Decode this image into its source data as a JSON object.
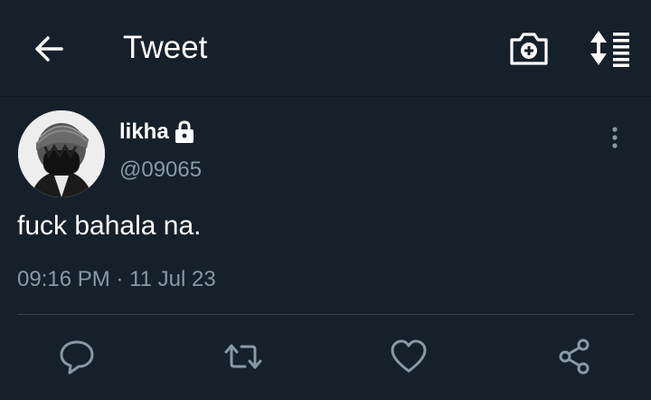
{
  "header": {
    "title": "Tweet",
    "back_icon": "arrow-left-icon",
    "camera_icon": "camera-plus-icon",
    "sort_icon": "sort-icon"
  },
  "tweet": {
    "display_name": "likha",
    "handle": "@09065",
    "text": "fuck bahala na.",
    "time": "09:16 PM",
    "separator": "·",
    "date": "11 Jul 23",
    "protected_icon": "lock-icon"
  },
  "actions": [
    "reply-icon",
    "retweet-icon",
    "like-icon",
    "share-icon"
  ],
  "colors": {
    "background": "#15202b",
    "secondary_text": "#8899a6",
    "divider": "#38444d"
  }
}
